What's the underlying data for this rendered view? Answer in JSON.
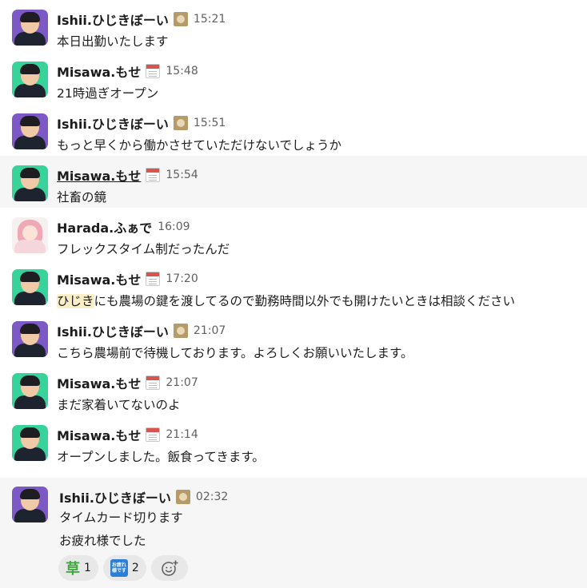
{
  "messages": [
    {
      "user": "Ishii.ひじきぼーい",
      "status_emoji": "cat-icon",
      "time": "15:21",
      "text": "本日出勤いたします",
      "avatar": "purple"
    },
    {
      "user": "Misawa.もせ",
      "status_emoji": "calendar-icon",
      "time": "15:48",
      "text": "21時過ぎオープン",
      "avatar": "green"
    },
    {
      "user": "Ishii.ひじきぼーい",
      "status_emoji": "cat-icon",
      "time": "15:51",
      "text": "もっと早くから働かさせていただけないでしょうか",
      "avatar": "purple"
    },
    {
      "user": "Misawa.もせ",
      "status_emoji": "calendar-icon",
      "time": "15:54",
      "text": "社畜の鏡",
      "avatar": "green"
    },
    {
      "user": "Harada.ふぁで",
      "status_emoji": "",
      "time": "16:09",
      "text": "フレックスタイム制だったんだ",
      "avatar": "pink"
    },
    {
      "user": "Misawa.もせ",
      "status_emoji": "calendar-icon",
      "time": "17:20",
      "mention": "ひじき",
      "text": "にも農場の鍵を渡してるので勤務時間以外でも開けたいときは相談ください",
      "avatar": "green"
    },
    {
      "user": "Ishii.ひじきぼーい",
      "status_emoji": "cat-icon",
      "time": "21:07",
      "text": "こちら農場前で待機しております。よろしくお願いいたします。",
      "avatar": "purple"
    },
    {
      "user": "Misawa.もせ",
      "status_emoji": "calendar-icon",
      "time": "21:07",
      "text": "まだ家着いてないのよ",
      "avatar": "green"
    },
    {
      "user": "Misawa.もせ",
      "status_emoji": "calendar-icon",
      "time": "21:14",
      "text": "オープンしました。飯食ってきます。",
      "avatar": "green"
    }
  ],
  "last_message": {
    "user": "Ishii.ひじきぼーい",
    "status_emoji": "cat-icon",
    "time": "02:32",
    "lines": [
      "タイムカード切ります",
      "お疲れ様でした"
    ],
    "reactions": [
      {
        "emoji": "草",
        "count": "1"
      },
      {
        "emoji": "お疲れ様です",
        "count": "2"
      }
    ],
    "add_reaction_icon": "add-emoji-icon"
  }
}
